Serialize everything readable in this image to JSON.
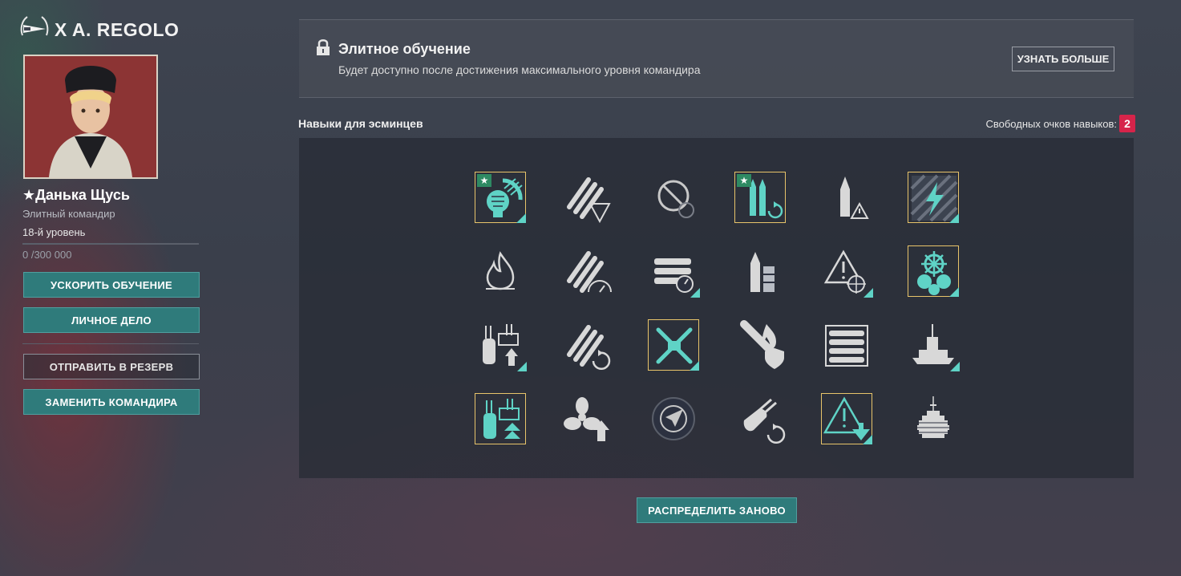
{
  "ship": {
    "name": "X A. REGOLO"
  },
  "commander": {
    "name": "★Данька Щусь",
    "rank": "Элитный командир",
    "level": "18-й уровень",
    "xp": "0 /300 000",
    "xp_progress": 0
  },
  "actions": {
    "accelerate": "УСКОРИТЬ ОБУЧЕНИЕ",
    "personal_file": "ЛИЧНОЕ ДЕЛО",
    "send_reserve": "ОТПРАВИТЬ В РЕЗЕРВ",
    "replace": "ЗАМЕНИТЬ КОМАНДИРА"
  },
  "elite": {
    "title": "Элитное обучение",
    "subtitle": "Будет доступно после достижения максимального уровня командира",
    "learn_more": "УЗНАТЬ БОЛЬШЕ"
  },
  "skills": {
    "heading": "Навыки для эсминцев",
    "free_points_label": "Свободных очков навыков:",
    "free_points": "2",
    "redistribute": "РАСПРЕДЕЛИТЬ ЗАНОВО"
  },
  "colors": {
    "accent": "#5fd3c6",
    "selected_border": "#e8c46a",
    "badge": "#d6244a",
    "button": "#2f7b7b"
  }
}
